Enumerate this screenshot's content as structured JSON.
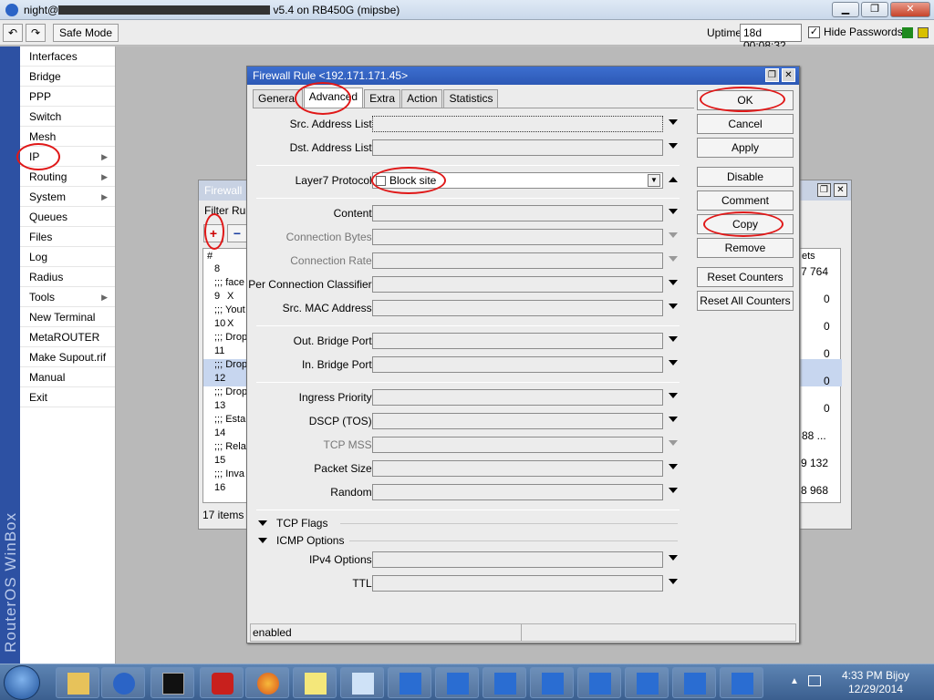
{
  "window": {
    "title_prefix": "night@",
    "title_suffix": " v5.4 on RB450G (mipsbe)"
  },
  "toolbar": {
    "undo_icon": "undo-icon",
    "redo_icon": "redo-icon",
    "safe_mode_label": "Safe Mode",
    "uptime_label": "Uptime:",
    "uptime_value": "18d 00:08:32",
    "hide_passwords_label": "Hide Passwords",
    "hide_passwords_checked": "✓"
  },
  "branding": {
    "rail_text": "RouterOS WinBox"
  },
  "menu": {
    "items": [
      {
        "label": "Interfaces"
      },
      {
        "label": "Bridge"
      },
      {
        "label": "PPP"
      },
      {
        "label": "Switch"
      },
      {
        "label": "Mesh"
      },
      {
        "label": "IP"
      },
      {
        "label": "Routing"
      },
      {
        "label": "System"
      },
      {
        "label": "Queues"
      },
      {
        "label": "Files"
      },
      {
        "label": "Log"
      },
      {
        "label": "Radius"
      },
      {
        "label": "Tools"
      },
      {
        "label": "New Terminal"
      },
      {
        "label": "MetaROUTER"
      },
      {
        "label": "Make Supout.rif"
      },
      {
        "label": "Manual"
      },
      {
        "label": "Exit"
      }
    ]
  },
  "firewall_window": {
    "title": "Firewall",
    "tab_label": "Filter Rule",
    "add_label": "+",
    "remove_label": "−",
    "col_hash": "#",
    "col_bytes": "ets",
    "rows": [
      {
        "num": "8",
        "text": ""
      },
      {
        "num": "",
        "text": ";;; face"
      },
      {
        "num": "9",
        "text": "X"
      },
      {
        "num": "",
        "text": ";;; Yout"
      },
      {
        "num": "10",
        "text": "X"
      },
      {
        "num": "",
        "text": ";;; Drop"
      },
      {
        "num": "11",
        "text": ""
      },
      {
        "num": "",
        "text": ";;; Drop"
      },
      {
        "num": "12",
        "text": ""
      },
      {
        "num": "",
        "text": ";;; Drop"
      },
      {
        "num": "13",
        "text": ""
      },
      {
        "num": "",
        "text": ";;; Esta"
      },
      {
        "num": "14",
        "text": ""
      },
      {
        "num": "",
        "text": ";;; Rela"
      },
      {
        "num": "15",
        "text": ""
      },
      {
        "num": "",
        "text": ";;; Inva"
      },
      {
        "num": "16",
        "text": ""
      }
    ],
    "values": [
      "7 764",
      "0",
      "0",
      "0",
      "0",
      "0",
      "88 ...",
      "9 132",
      "8 968"
    ],
    "status": "17 items (1"
  },
  "dialog": {
    "title": "Firewall Rule <192.171.171.45>",
    "tabs": [
      "General",
      "Advanced",
      "Extra",
      "Action",
      "Statistics"
    ],
    "fields": {
      "src_address_list": "Src. Address List:",
      "dst_address_list": "Dst. Address List:",
      "layer7_protocol": "Layer7 Protocol:",
      "layer7_value": "Block site",
      "content": "Content:",
      "connection_bytes": "Connection Bytes:",
      "connection_rate": "Connection Rate:",
      "per_connection_classifier": "Per Connection Classifier:",
      "src_mac_address": "Src. MAC Address:",
      "out_bridge_port": "Out. Bridge Port:",
      "in_bridge_port": "In. Bridge Port:",
      "ingress_priority": "Ingress Priority:",
      "dscp_tos": "DSCP (TOS):",
      "tcp_mss": "TCP MSS:",
      "packet_size": "Packet Size:",
      "random": "Random:",
      "ipv4_options": "IPv4 Options:",
      "ttl": "TTL:"
    },
    "sections": {
      "tcp_flags": "TCP Flags",
      "icmp_options": "ICMP Options"
    },
    "buttons": {
      "ok": "OK",
      "cancel": "Cancel",
      "apply": "Apply",
      "disable": "Disable",
      "comment": "Comment",
      "copy": "Copy",
      "remove": "Remove",
      "reset_counters": "Reset Counters",
      "reset_all_counters": "Reset All Counters"
    },
    "status": "enabled"
  },
  "taskbar": {
    "time": "4:33 PM Bijoy",
    "date": "12/29/2014"
  },
  "colors": {
    "annotation_red": "#e01818",
    "winbox_blue": "#2d51a3",
    "titlebar_blue": "#2c58b5"
  }
}
